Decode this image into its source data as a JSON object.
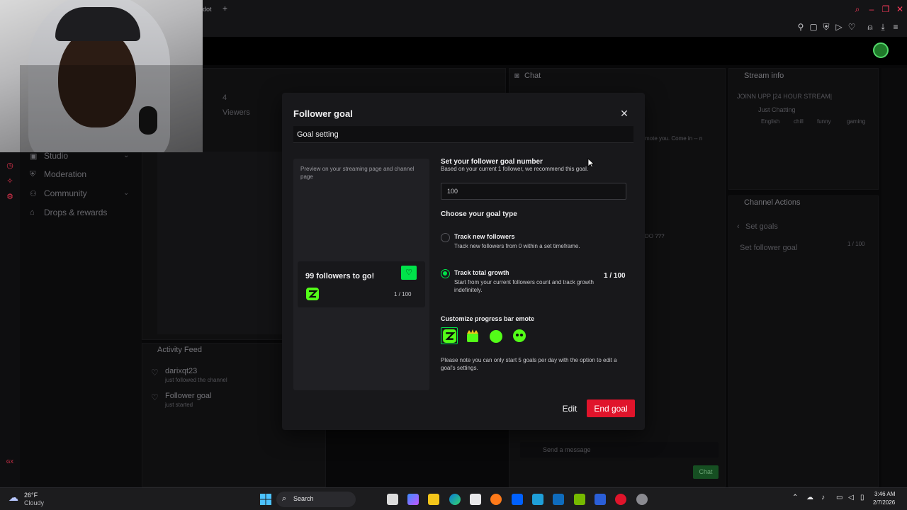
{
  "browser": {
    "tab_text": "dot",
    "new_tab_label": "+"
  },
  "dashboard": {
    "nav": [
      {
        "label": "Studio",
        "icon": "camera-icon"
      },
      {
        "label": "Moderation",
        "icon": "shield-icon"
      },
      {
        "label": "Community",
        "icon": "users-icon"
      },
      {
        "label": "Drops & rewards",
        "icon": "gift-icon"
      }
    ],
    "stats": {
      "value": "4",
      "label": "Viewers"
    },
    "activity_feed": {
      "title": "Activity Feed",
      "items": [
        {
          "name": "darixqt23",
          "detail": "just followed the channel"
        },
        {
          "name": "Follower goal",
          "detail": "just started"
        }
      ]
    },
    "chat": {
      "title": "Chat",
      "message_snippet": "mote you. Come in -- n",
      "qmarks": "DO ???",
      "input_placeholder": "Send a message",
      "send_label": "Chat"
    },
    "stream_info": {
      "title": "Stream info",
      "stream_title": "JOINN UPP |24 HOUR STREAM|",
      "category": "Just Chatting",
      "tags": [
        "English",
        "chill",
        "funny",
        "gaming"
      ]
    },
    "channel_actions": {
      "title": "Channel Actions",
      "back_label": "Set goals",
      "item_label": "Set follower goal",
      "item_value": "1 / 100"
    }
  },
  "modal": {
    "title": "Follower goal",
    "tab": "Goal setting",
    "preview": {
      "description": "Preview on your streaming page and channel page",
      "card_title": "99 followers to go!",
      "count": "1 / 100"
    },
    "goal_number": {
      "title": "Set your follower goal number",
      "subtitle": "Based on your current 1 follower, we recommend this goal.",
      "value": "100"
    },
    "goal_type": {
      "title": "Choose your goal type",
      "options": [
        {
          "label": "Track new followers",
          "desc": "Track new followers from 0 within a set timeframe.",
          "selected": false
        },
        {
          "label": "Track total growth",
          "desc": "Start from your current followers count and track growth indefinitely.",
          "selected": true,
          "value": "1 / 100"
        }
      ]
    },
    "emote": {
      "title": "Customize progress bar emote",
      "options": [
        "kick-logo-emote",
        "crown-emote",
        "blob-emote",
        "blob-face-emote"
      ],
      "selected": 0
    },
    "note": "Please note you can only start 5 goals per day with the option to edit a goal's settings.",
    "edit_label": "Edit",
    "end_label": "End goal"
  },
  "taskbar": {
    "weather_temp": "26°F",
    "weather_desc": "Cloudy",
    "search_label": "Search",
    "time": "3:46 AM",
    "date": "2/7/2026"
  },
  "colors": {
    "accent_green": "#00e34a",
    "danger_red": "#e0142b",
    "modal_bg": "#18181b"
  }
}
